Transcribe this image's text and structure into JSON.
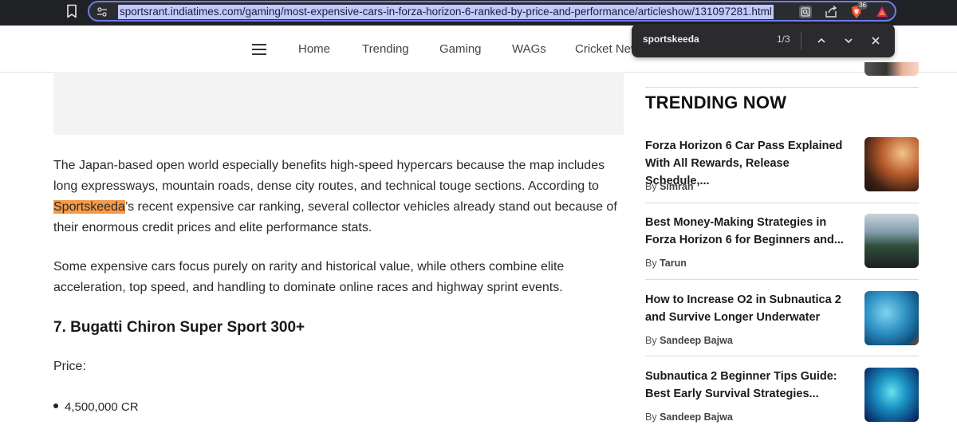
{
  "browser": {
    "url": "sportsrant.indiatimes.com/gaming/most-expensive-cars-in-forza-horizon-6-ranked-by-price-and-performance/articleshow/131097281.html",
    "brave_badge_count": "36",
    "accent_color": "#6f7bf0"
  },
  "nav": {
    "items": [
      "Home",
      "Trending",
      "Gaming",
      "WAGs",
      "Cricket News"
    ]
  },
  "find_bar": {
    "query": "sportskeeda",
    "match_count": "1/3"
  },
  "article": {
    "para1_before": "The Japan-based open world especially benefits high-speed hypercars because the map includes long expressways, mountain roads, dense city routes, and technical touge sections. According to ",
    "para1_highlight": "Sportskeeda",
    "para1_after": "’s recent expensive car ranking, several collector vehicles already stand out because of their enormous credit prices and elite performance stats.",
    "para2": "Some expensive cars focus purely on rarity and historical value, while others combine elite acceleration, top speed, and handling to dominate online races and highway sprint events.",
    "heading": "7. Bugatti Chiron Super Sport 300+",
    "price_label": "Price:",
    "price_items": [
      "4,500,000 CR"
    ]
  },
  "sidebar": {
    "title": "TRENDING NOW",
    "by_prefix": "By",
    "cards": [
      {
        "title": "Forza Horizon 6 Car Pass Explained With All Rewards, Release Schedule,...",
        "author": "Simran"
      },
      {
        "title": "Best Money-Making Strategies in Forza Horizon 6 for Beginners and...",
        "author": "Tarun"
      },
      {
        "title": "How to Increase O2 in Subnautica 2 and Survive Longer Underwater",
        "author": "Sandeep Bajwa"
      },
      {
        "title": "Subnautica 2 Beginner Tips Guide: Best Early Survival Strategies...",
        "author": "Sandeep Bajwa"
      }
    ]
  }
}
